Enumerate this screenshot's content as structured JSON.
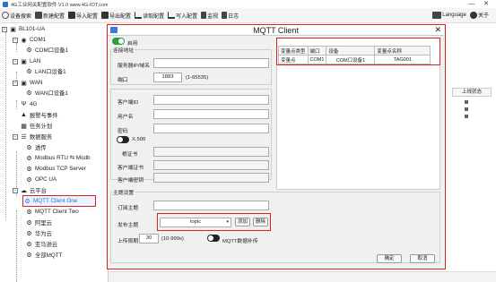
{
  "app": {
    "title": "4G工业网关配置软件 V1.0 www.4G-IOT.com",
    "win_controls": "— ✕"
  },
  "toolbar": {
    "items": [
      {
        "label": "设备搜索"
      },
      {
        "label": "新建配置"
      },
      {
        "label": "导入配置"
      },
      {
        "label": "导出配置"
      },
      {
        "label": "读取配置"
      },
      {
        "label": "写入配置"
      },
      {
        "label": "监视"
      },
      {
        "label": "日志"
      }
    ],
    "language": "Language",
    "about": "关于"
  },
  "tree": {
    "root": "BL101-UA",
    "com1": "COM1",
    "com1_dev": "COM口设备1",
    "lan": "LAN",
    "lan_dev": "LAN口设备1",
    "wan": "WAN",
    "wan_dev": "WAN口设备1",
    "g4": "4G",
    "alarm": "报警与事件",
    "task": "任务计划",
    "data_service": "数据服务",
    "passthrough": "透传",
    "modbus_rtu": "Modbus RTU ⇆ Modb",
    "modbus_tcp": "Modbus TCP Server",
    "opcua": "OPC UA",
    "cloud": "云平台",
    "mqtt1": "MQTT Client One",
    "mqtt2": "MQTT Client Two",
    "aliyun": "阿里云",
    "huawei": "华为云",
    "aws": "亚马逊云",
    "more": "全部MQTT"
  },
  "bg_panel": {
    "header": "上线状态"
  },
  "dialog": {
    "title": "MQTT Client",
    "enable_label": "启用",
    "server_group": "连接地址",
    "server_label": "服务器IP/域名",
    "server_value": "",
    "port_label": "端口",
    "port_value": "1883",
    "port_hint": "(1-65535)",
    "client_id_label": "客户端ID",
    "username_label": "用户名",
    "password_label": "密码",
    "x509_label": "X.509",
    "root_cert_label": "根证书",
    "client_cert_label": "客户端证书",
    "client_key_label": "客户端密钥",
    "topic_group": "主题设置",
    "sub_label": "订阅主题",
    "pub_label": "发布主题",
    "pub_select": "topic",
    "add_btn": "添加",
    "del_btn": "删除",
    "period_label": "上传周期",
    "period_value": "30",
    "period_hint": "(10-999s)",
    "mqtt_format": "MQTT数据补传",
    "ok_btn": "确定",
    "cancel_btn": "取消",
    "table": {
      "headers": [
        "变量点类型",
        "端口",
        "设备",
        "变量点名称"
      ],
      "rows": [
        [
          "变量点",
          "COM1",
          "COM口设备1",
          "TAG001"
        ]
      ]
    }
  },
  "colors": {
    "accent": "#e02020",
    "toggle_on": "#2e9e3a",
    "selection": "#2d6fd0"
  }
}
